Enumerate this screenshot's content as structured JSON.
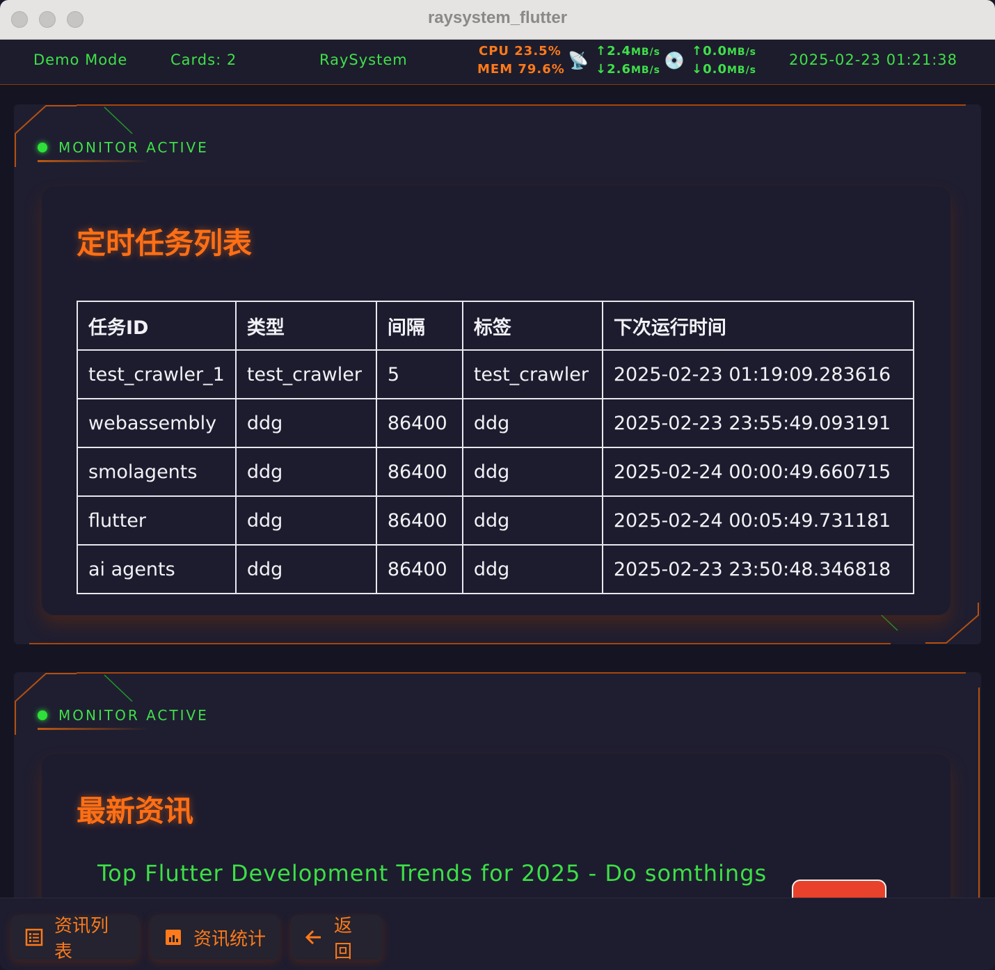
{
  "window": {
    "title": "raysystem_flutter"
  },
  "status": {
    "mode": "Demo Mode",
    "cards": "Cards: 2",
    "app_name": "RaySystem",
    "cpu": "CPU 23.5%",
    "mem": "MEM 79.6%",
    "net_up": "↑2.4",
    "net_down": "↓2.6",
    "disk_up": "↑0.0",
    "disk_down": "↓0.0",
    "rate_unit": "MB/s",
    "datetime": "2025-02-23 01:21:38",
    "satellite_icon": "📡",
    "disk_icon": "💿"
  },
  "cards": [
    {
      "monitor_label": "MONITOR ACTIVE",
      "title": "定时任务列表"
    },
    {
      "monitor_label": "MONITOR ACTIVE",
      "title": "最新资讯"
    }
  ],
  "tasks": {
    "headers": [
      "任务ID",
      "类型",
      "间隔",
      "标签",
      "下次运行时间"
    ],
    "rows": [
      [
        "test_crawler_1",
        "test_crawler",
        "5",
        "test_crawler",
        "2025-02-23 01:19:09.283616"
      ],
      [
        "webassembly",
        "ddg",
        "86400",
        "ddg",
        "2025-02-23 23:55:49.093191"
      ],
      [
        "smolagents",
        "ddg",
        "86400",
        "ddg",
        "2025-02-24 00:00:49.660715"
      ],
      [
        "flutter",
        "ddg",
        "86400",
        "ddg",
        "2025-02-24 00:05:49.731181"
      ],
      [
        "ai agents",
        "ddg",
        "86400",
        "ddg",
        "2025-02-23 23:50:48.346818"
      ]
    ]
  },
  "news": {
    "first_item": "Top Flutter Development Trends for 2025 - Do somthings"
  },
  "bottom": {
    "news_list": "资讯列表",
    "news_stats": "资讯统计",
    "back": "返回"
  },
  "colors": {
    "accent": "#ff6f14",
    "green": "#3fe04a",
    "bg": "#1f1e30",
    "danger": "#e8412c"
  }
}
